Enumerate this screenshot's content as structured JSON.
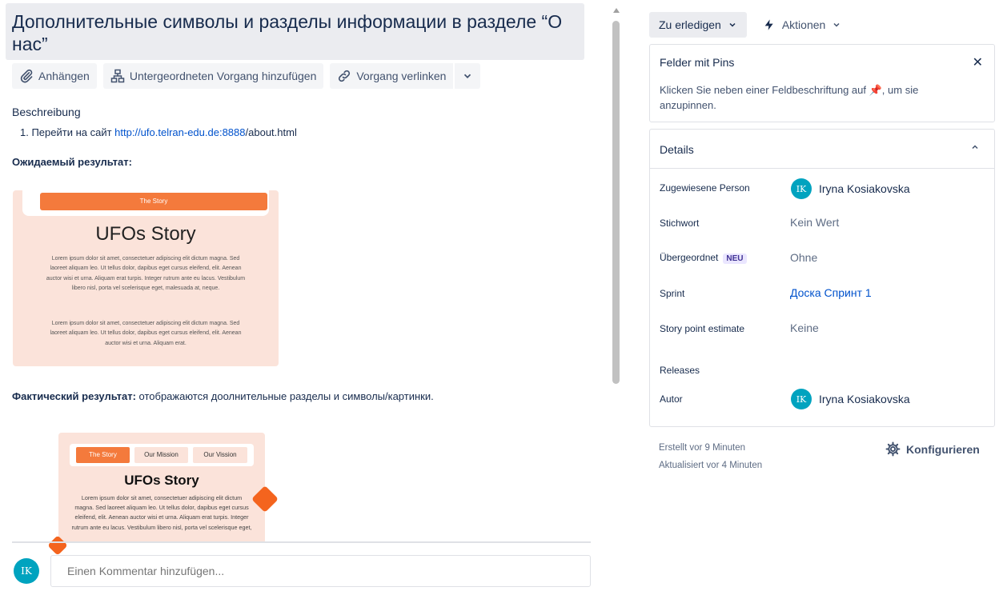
{
  "issue": {
    "title": "Дополнительные символы и разделы информации в разделе “О нас”"
  },
  "toolbar": {
    "attach_label": "Anhängen",
    "add_child_label": "Untergeordneten Vorgang hinzufügen",
    "link_label": "Vorgang verlinken"
  },
  "description": {
    "label": "Beschreibung",
    "step_prefix": "1. Перейти на сайт ",
    "step_link": "http://ufo.telran-edu.de:8888",
    "step_suffix": "/about.html",
    "expected_label": "Ожидаемый результат:",
    "actual_label": "Фактический результат:",
    "actual_text": " отображаются доолнительные разделы и символы/картинки."
  },
  "expected_image": {
    "tab": "The Story",
    "heading": "UFOs Story",
    "para1": "Lorem ipsum dolor sit amet, consectetuer adipiscing elit dictum magna. Sed laoreet aliquam leo. Ut tellus dolor, dapibus eget cursus eleifend, elit. Aenean auctor wisi et urna. Aliquam erat turpis. Integer rutrum ante eu lacus. Vestibulum libero nisl, porta vel scelerisque eget, malesuada at, neque.",
    "para2": "Lorem ipsum dolor sit amet, consectetuer adipiscing elit dictum magna. Sed laoreet aliquam leo. Ut tellus dolor, dapibus eget cursus eleifend, elit. Aenean auctor wisi et urna. Aliquam erat."
  },
  "actual_image": {
    "tabs": [
      "The Story",
      "Our Mission",
      "Our Vission"
    ],
    "heading": "UFOs Story",
    "para": "Lorem ipsum dolor sit amet, consectetuer adipiscing elit dictum magna. Sed laoreet aliquam leo. Ut tellus dolor, dapibus eget cursus eleifend, elit. Aenean auctor wisi et urna. Aliquam erat turpis. Integer rutrum ante eu lacus. Vestibulum libero nisl, porta vel scelerisque eget,"
  },
  "comment": {
    "avatar": "IK",
    "placeholder": "Einen Kommentar hinzufügen..."
  },
  "header_buttons": {
    "status": "Zu erledigen",
    "actions": "Aktionen"
  },
  "pins": {
    "title": "Felder mit Pins",
    "text_before": "Klicken Sie neben einer Feldbeschriftung auf ",
    "text_after": ", um sie anzupinnen."
  },
  "details": {
    "title": "Details",
    "assignee_label": "Zugewiesene Person",
    "assignee_avatar": "IK",
    "assignee_name": "Iryna Kosiakovska",
    "label_label": "Stichwort",
    "label_value": "Kein Wert",
    "parent_label": "Übergeordnet",
    "parent_badge": "NEU",
    "parent_value": "Ohne",
    "sprint_label": "Sprint",
    "sprint_value": "Доска Спринт 1",
    "estimate_label": "Story point estimate",
    "estimate_value": "Keine",
    "releases_label": "Releases",
    "reporter_label": "Autor",
    "reporter_avatar": "IK",
    "reporter_name": "Iryna Kosiakovska"
  },
  "meta": {
    "created": "Erstellt vor 9 Minuten",
    "updated": "Aktualisiert vor 4 Minuten",
    "configure": "Konfigurieren"
  },
  "colors": {
    "accent": "#0052cc",
    "avatar": "#00a3bf",
    "orange": "#f47a3c"
  }
}
